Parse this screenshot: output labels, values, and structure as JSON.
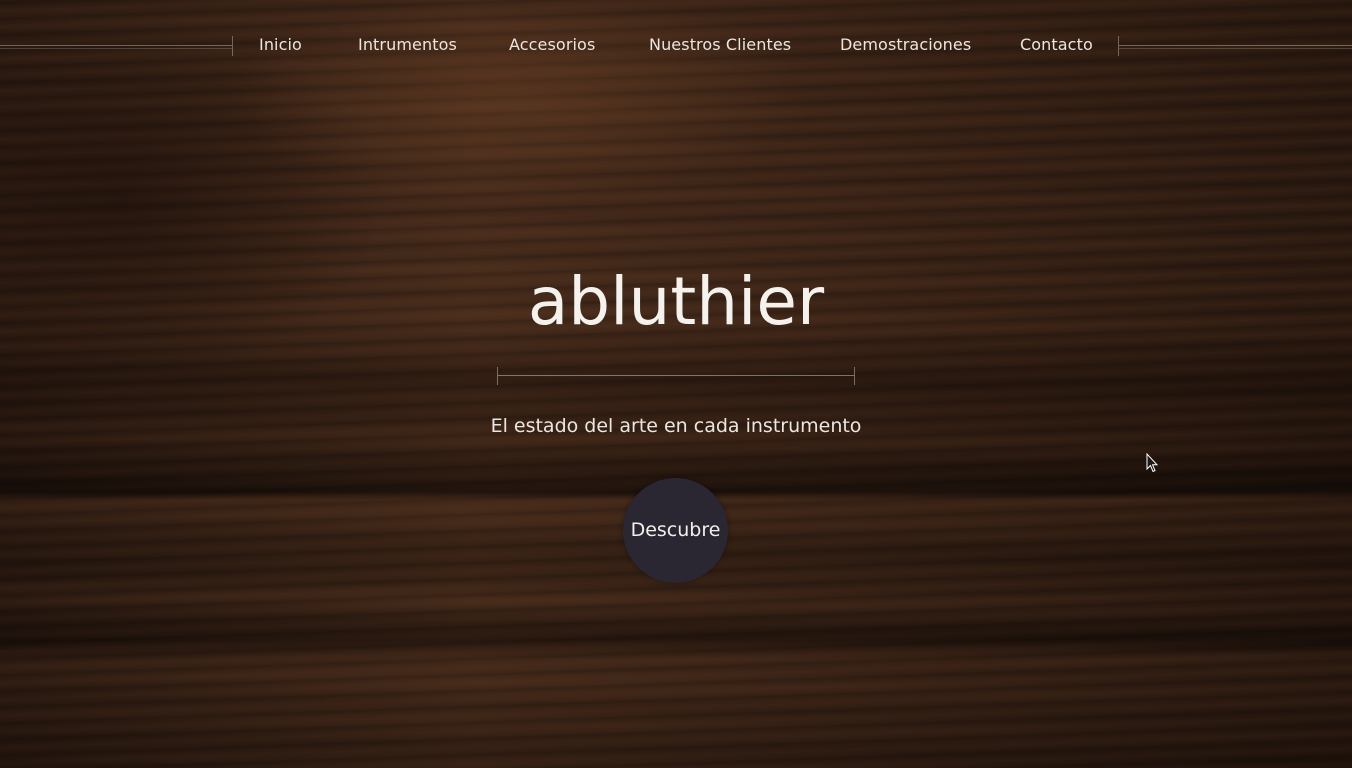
{
  "nav": {
    "items": [
      {
        "label": "Inicio"
      },
      {
        "label": "Intrumentos"
      },
      {
        "label": "Accesorios"
      },
      {
        "label": "Nuestros Clientes"
      },
      {
        "label": "Demostraciones"
      },
      {
        "label": "Contacto"
      }
    ]
  },
  "hero": {
    "title": "abluthier",
    "tagline": "El estado del arte en cada instrumento",
    "cta_label": "Descubre"
  },
  "colors": {
    "wood_base": "#3b2418",
    "cta_background": "#2a2732",
    "text": "#f2ece6"
  },
  "icons": {
    "cursor": "mouse-pointer-icon"
  }
}
